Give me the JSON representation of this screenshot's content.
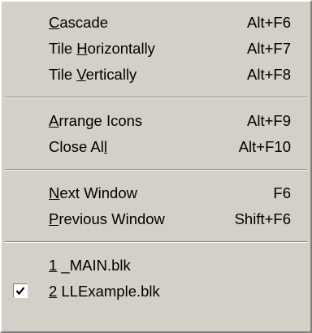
{
  "menu": {
    "groups": [
      {
        "items": [
          {
            "id": "cascade",
            "pre": "",
            "acc": "C",
            "post": "ascade",
            "shortcut": "Alt+F6"
          },
          {
            "id": "tile-horizontally",
            "pre": "Tile ",
            "acc": "H",
            "post": "orizontally",
            "shortcut": "Alt+F7"
          },
          {
            "id": "tile-vertically",
            "pre": "Tile ",
            "acc": "V",
            "post": "ertically",
            "shortcut": "Alt+F8"
          }
        ]
      },
      {
        "items": [
          {
            "id": "arrange-icons",
            "pre": "",
            "acc": "A",
            "post": "rrange Icons",
            "shortcut": "Alt+F9"
          },
          {
            "id": "close-all",
            "pre": "Close Al",
            "acc": "l",
            "post": "",
            "shortcut": "Alt+F10"
          }
        ]
      },
      {
        "items": [
          {
            "id": "next-window",
            "pre": "",
            "acc": "N",
            "post": "ext Window",
            "shortcut": "F6"
          },
          {
            "id": "previous-window",
            "pre": "",
            "acc": "P",
            "post": "revious Window",
            "shortcut": "Shift+F6"
          }
        ]
      },
      {
        "items": [
          {
            "id": "window-1-main",
            "pre": "",
            "acc": "1",
            "post": " _MAIN.blk",
            "shortcut": "",
            "checked": false
          },
          {
            "id": "window-2-llexample",
            "pre": "",
            "acc": "2",
            "post": " LLExample.blk",
            "shortcut": "",
            "checked": true
          }
        ]
      }
    ]
  }
}
